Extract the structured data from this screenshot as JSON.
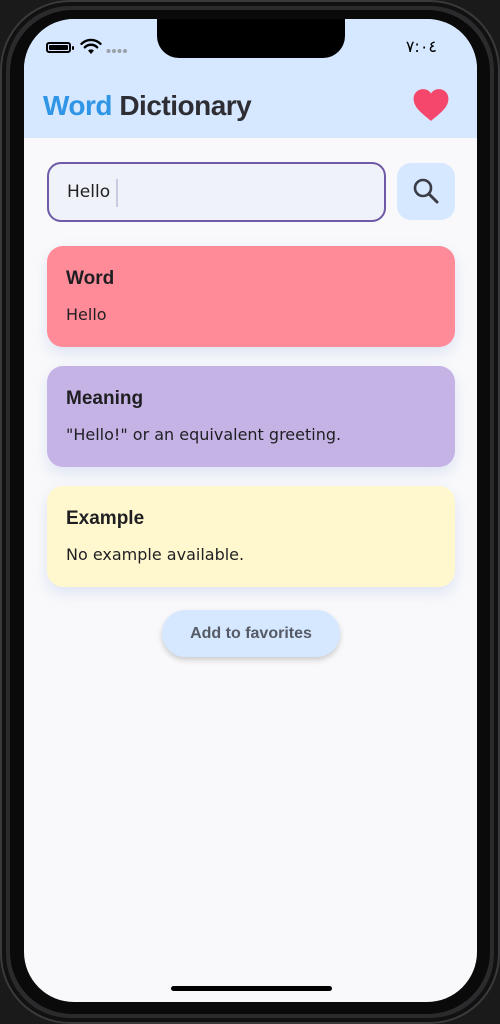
{
  "status_bar": {
    "time": "٧:٠٤",
    "icons": [
      "battery-icon",
      "wifi-icon",
      "signal-icon"
    ]
  },
  "app_bar": {
    "title_part1": "Word",
    "title_part2": "Dictionary",
    "favorites_icon": "heart-icon",
    "title_accent_color": "#2f95e6",
    "heart_color": "#f4476b",
    "background": "#d6e8ff"
  },
  "search": {
    "value": "Hello",
    "button_icon": "search-icon"
  },
  "cards": {
    "word": {
      "label": "Word",
      "value": "Hello",
      "color": "#ff8a98"
    },
    "meaning": {
      "label": "Meaning",
      "value": "\"Hello!\" or an equivalent greeting.",
      "color": "#c6b3e6"
    },
    "example": {
      "label": "Example",
      "value": "No example available.",
      "color": "#fff8cf"
    }
  },
  "actions": {
    "add_to_favorites": "Add to favorites"
  }
}
